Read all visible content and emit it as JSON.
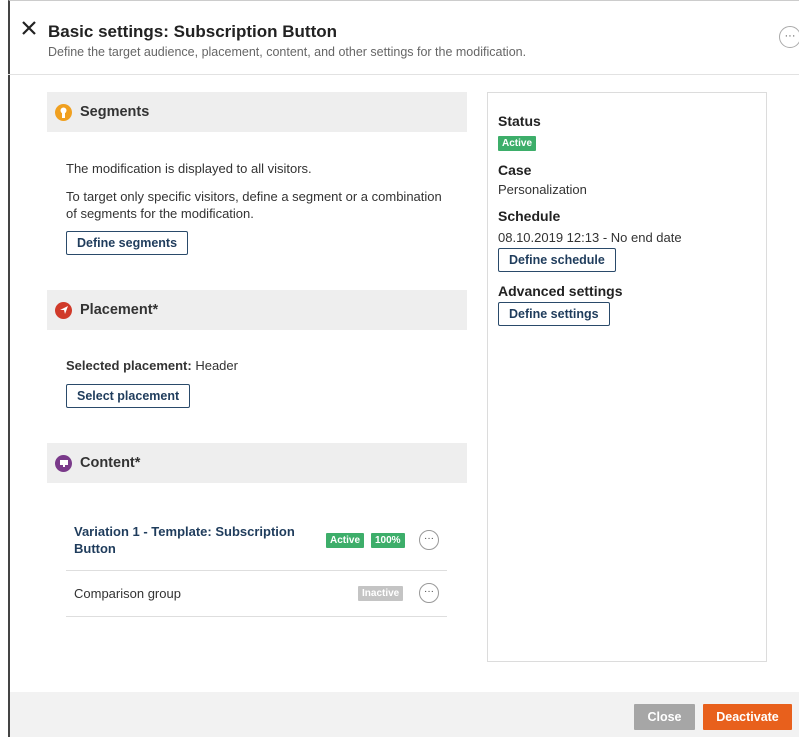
{
  "header": {
    "title": "Basic settings: Subscription Button",
    "subtitle": "Define the target audience, placement, content, and other settings for the modification.",
    "more_label": "···"
  },
  "segments": {
    "title": "Segments",
    "icon": "segments-icon",
    "icon_color": "#f0a020",
    "line1": "The modification is displayed to all visitors.",
    "line2": "To target only specific visitors, define a segment or a combination",
    "line3": "of segments for the modification.",
    "button_label": "Define segments"
  },
  "placement": {
    "title": "Placement*",
    "icon": "placement-icon",
    "icon_color": "#d03a2a",
    "selected_label": "Selected placement:",
    "selected_value": " Header",
    "button_label": "Select placement"
  },
  "content": {
    "title": "Content*",
    "icon": "content-icon",
    "icon_color": "#7a3a8a",
    "variations": [
      {
        "name_line1": "Variation 1 - Template: Subscription",
        "name_line2": "Button",
        "status": "Active",
        "share": "100%",
        "more": "···"
      },
      {
        "name": "Comparison group",
        "status": "Inactive",
        "more": "···"
      }
    ]
  },
  "sidebar": {
    "status_label": "Status",
    "status_value": "Active",
    "case_label": "Case",
    "case_value": "Personalization",
    "schedule_label": "Schedule",
    "schedule_value": "08.10.2019 12:13 - No end date",
    "schedule_button": "Define schedule",
    "advanced_label": "Advanced settings",
    "advanced_button": "Define settings"
  },
  "footer": {
    "close_label": "Close",
    "deactivate_label": "Deactivate"
  },
  "colors": {
    "accent": "#e8601c",
    "active_badge": "#3dae6a",
    "inactive_badge": "#c4c4c4",
    "link": "#1f3c5c"
  }
}
